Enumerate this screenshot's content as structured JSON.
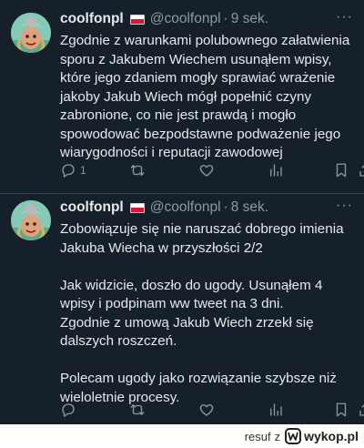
{
  "tweets": [
    {
      "display_name": "coolfonpl",
      "handle": "@coolfonpl",
      "separator": "·",
      "time": "9 sek.",
      "text": "Zgodnie z warunkami polubownego załatwienia\nsporu z Jakubem Wiechem usunąłem wpisy,\nktóre jego zdaniem mogły sprawiać wrażenie\njakoby Jakub Wiech mógł popełnić czyny\nzabronione, co nie jest prawdą i mogło\nspowodować bezpodstawne podważenie jego\nwiarygodności i reputacji zawodowej",
      "reply_count": "1",
      "more": "···"
    },
    {
      "display_name": "coolfonpl",
      "handle": "@coolfonpl",
      "separator": "·",
      "time": "8 sek.",
      "text": "Zobowiązuje się nie naruszać dobrego imienia\nJakuba Wiecha w przyszłości 2/2\n\nJak widzicie, doszło do ugody. Usunąłem 4\nwpisy i podpinam ww tweet na 3 dni.\nZgodnie z umową Jakub Wiech zrzekł się\ndalszych roszczeń.\n\nPolecam ugody jako rozwiązanie szybsze niż\nwieloletnie procesy.",
      "reply_count": "",
      "more": "···"
    }
  ],
  "icons": {
    "flag": "poland-flag-icon",
    "reply": "reply-icon",
    "retweet": "retweet-icon",
    "like": "heart-icon",
    "views": "views-icon",
    "bookmark": "bookmark-icon",
    "share": "share-icon"
  },
  "colors": {
    "background": "#15202b",
    "text": "#e7e9ea",
    "secondary": "#8b98a5",
    "divider": "#38444d"
  },
  "watermark": {
    "user": "resuf",
    "z": "z",
    "site": "wykop.pl"
  }
}
